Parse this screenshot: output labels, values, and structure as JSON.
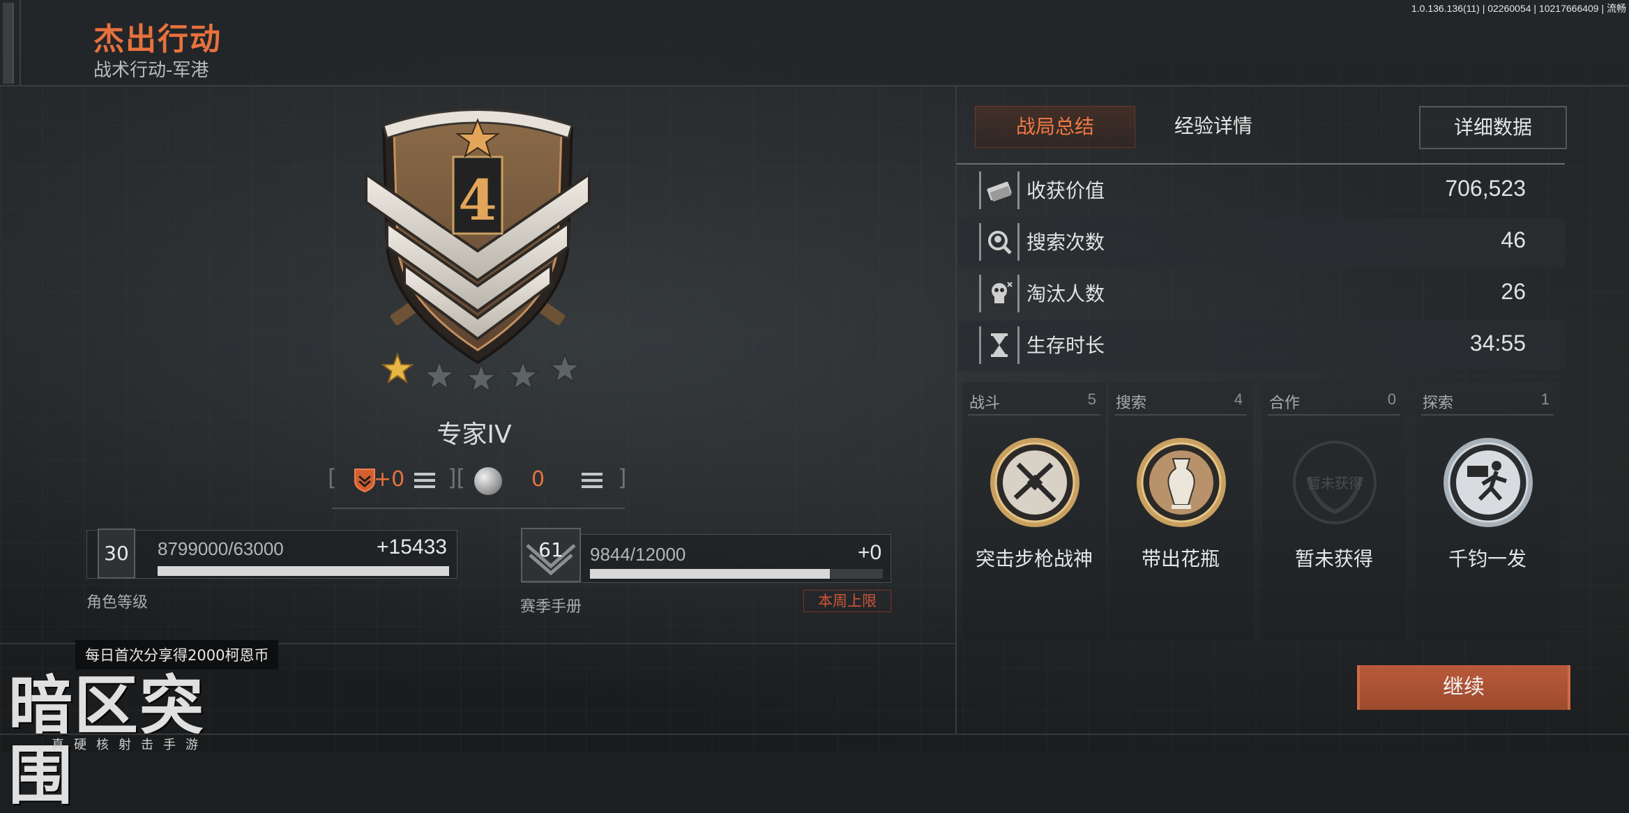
{
  "header": {
    "title": "杰出行动",
    "subtitle": "战术行动-军港",
    "version": "1.0.136.136(11) | 02260054 | 10217666409 | 流畅"
  },
  "rank": {
    "badge_number": "4",
    "name": "专家IV",
    "stars_filled": 1,
    "stars_total": 5
  },
  "currency": {
    "bracket_open": "[",
    "bracket_mid": "][",
    "bracket_close": "]",
    "merit_value": "+0",
    "coin_value": "0"
  },
  "character_level": {
    "level": "30",
    "progress_text": "8799000/63000",
    "gain": "+15433",
    "progress": 1.0,
    "label": "角色等级"
  },
  "season_pass": {
    "level": "61",
    "progress_text": "9844/12000",
    "gain": "+0",
    "progress": 0.82,
    "label": "赛季手册",
    "limit_label": "本周上限"
  },
  "tabs": {
    "summary": "战局总结",
    "exp": "经验详情",
    "detail": "详细数据"
  },
  "stats": [
    {
      "label": "收获价值",
      "value": "706,523",
      "icon": "money-icon"
    },
    {
      "label": "搜索次数",
      "value": "46",
      "icon": "search-icon"
    },
    {
      "label": "淘汰人数",
      "value": "26",
      "icon": "skull-icon"
    },
    {
      "label": "生存时长",
      "value": "34:55",
      "icon": "hourglass-icon"
    }
  ],
  "achievements": [
    {
      "category": "战斗",
      "count": "5",
      "name": "突击步枪战神",
      "icon": "rifle-medal-icon"
    },
    {
      "category": "搜索",
      "count": "4",
      "name": "带出花瓶",
      "icon": "vase-medal-icon"
    },
    {
      "category": "合作",
      "count": "0",
      "name": "暂未获得",
      "icon": "locked-medal-icon",
      "medal_text": "暂未获得"
    },
    {
      "category": "探索",
      "count": "1",
      "name": "千钧一发",
      "icon": "runner-medal-icon"
    }
  ],
  "share_tip": "每日首次分享得2000柯恩币",
  "logo": {
    "main": "暗区突围",
    "sub": "真硬核射击手游"
  },
  "continue_label": "继续",
  "colors": {
    "accent": "#e8713e",
    "continue_button": "#a94f31",
    "gold": "#c9a060"
  }
}
